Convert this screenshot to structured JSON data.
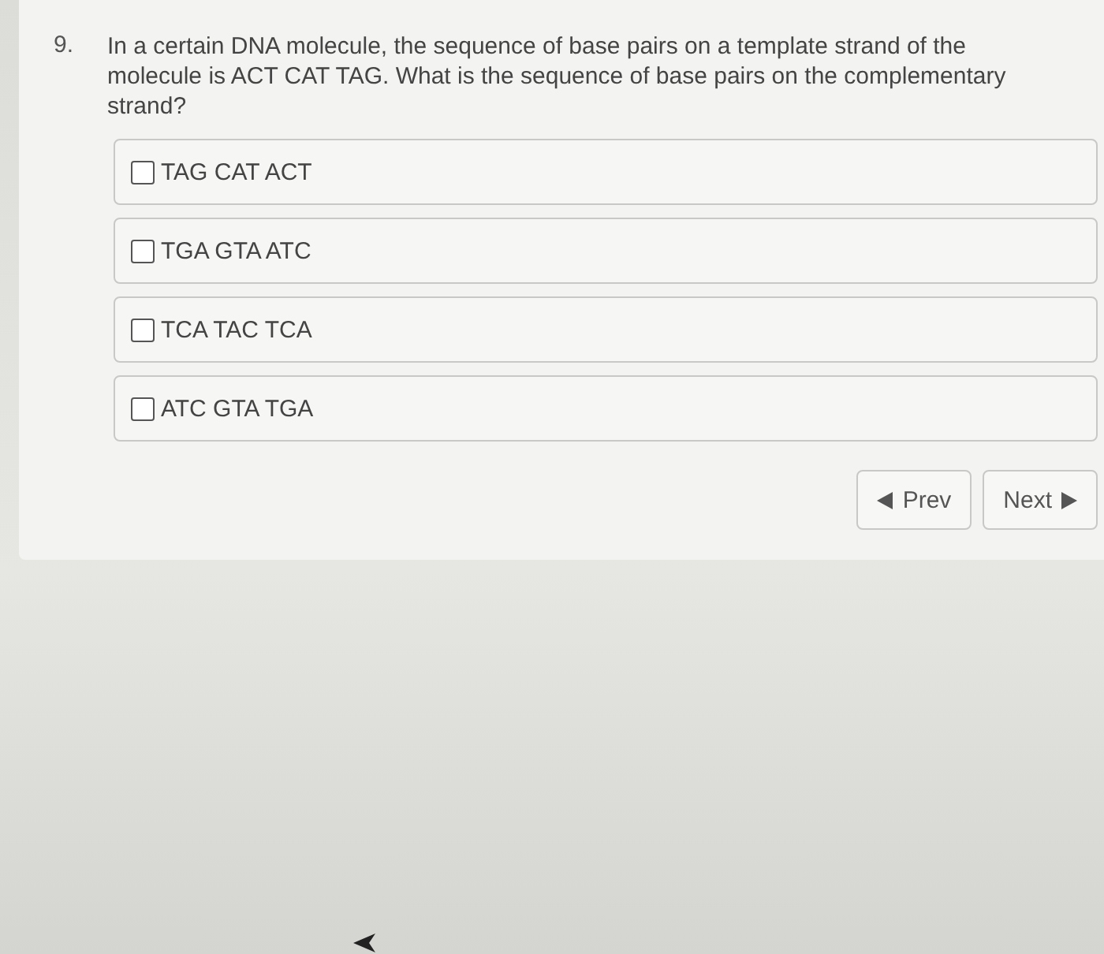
{
  "question": {
    "number": "9.",
    "text": "In a certain DNA molecule, the sequence of base pairs on a template strand of the molecule is ACT CAT TAG. What is the sequence of base pairs on the complementary strand?"
  },
  "options": [
    {
      "label": "TAG CAT ACT",
      "checked": false
    },
    {
      "label": "TGA GTA ATC",
      "checked": false
    },
    {
      "label": "TCA TAC TCA",
      "checked": false
    },
    {
      "label": "ATC GTA TGA",
      "checked": false
    }
  ],
  "navigation": {
    "prev": "Prev",
    "next": "Next"
  }
}
